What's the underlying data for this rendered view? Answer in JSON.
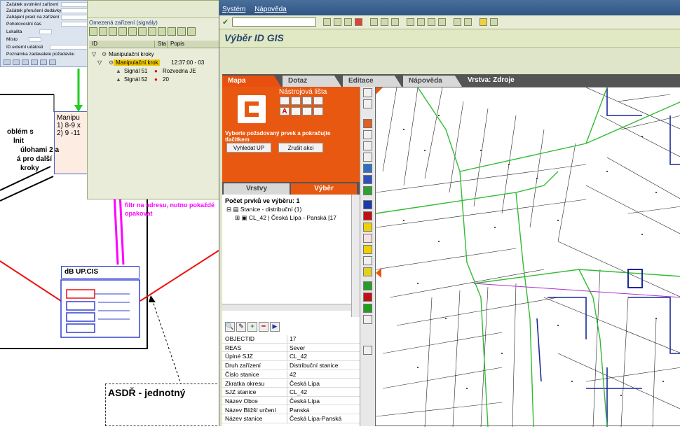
{
  "form_window": {
    "rows": [
      "Začátek uvolnění zařízení",
      "Začátek přerušení dodávky",
      "Zahájení prací na zařízení",
      "Pohotovostní čas",
      "Lokalita",
      "Místo",
      "ID externí události",
      "Poznámka zadavatele požadavku"
    ]
  },
  "signals_window": {
    "title": "Omezená zařízení (signály)",
    "headers": [
      "ID",
      "Sta",
      "Popis"
    ],
    "tree": [
      {
        "label": "Manipulační kroky",
        "status": "",
        "desc": ""
      },
      {
        "label": "Manipulační krok",
        "status": "",
        "desc": "12:37:00 - 03"
      },
      {
        "label": "Signál 51",
        "status": "red",
        "desc": "Rozvodna JE"
      },
      {
        "label": "Signál 52",
        "status": "red",
        "desc": "20"
      }
    ]
  },
  "diagram": {
    "manip_title": "Manipu",
    "manip_line1": "1) 8-9 x",
    "manip_line2": "2) 9 -11",
    "problem_text": [
      "oblém s",
      "lnit",
      "úlohami 2 a",
      "á pro další",
      "kroky"
    ],
    "magenta_note": "filtr na adresu, nutno pokaždé opakovat",
    "db_label": "dB UP.CIS",
    "asdr_label": "ASDŘ - jednotný"
  },
  "sap": {
    "menu": [
      "Systém",
      "Nápověda"
    ],
    "title": "Výběr ID GIS",
    "tabs": [
      "Mapa",
      "Dotaz",
      "Editace",
      "Nápověda"
    ],
    "layer_label": "Vrstva: Zdroje",
    "toolbar_title": "Nástrojová lišta",
    "hint": "Vyberte požadovaný prvek a pokračujte tlačítkem",
    "btn_search": "Vyhledat UP",
    "btn_cancel": "Zrušit akci",
    "subtabs": [
      "Vrstvy",
      "Výběr"
    ],
    "count_label": "Počet prvků ve výběru: 1",
    "tree_root": "Stanice - distribuční (1)",
    "tree_item": "CL_42 | Česká Lípa - Panská [17",
    "attributes": [
      [
        "OBJECTID",
        "17"
      ],
      [
        "REAS",
        "Sever"
      ],
      [
        "Úplné SJZ",
        "CL_42"
      ],
      [
        "Druh zařízení",
        "Distribuční stanice"
      ],
      [
        "Číslo stanice",
        "42"
      ],
      [
        "Zkratka okresu",
        "Česká Lípa"
      ],
      [
        "SJZ stanice",
        "CL_42"
      ],
      [
        "Název Obce",
        "Česká Lípa"
      ],
      [
        "Název Bližší určení",
        "Panská"
      ],
      [
        "Název stanice",
        "Česká Lípa-Panská"
      ]
    ]
  }
}
